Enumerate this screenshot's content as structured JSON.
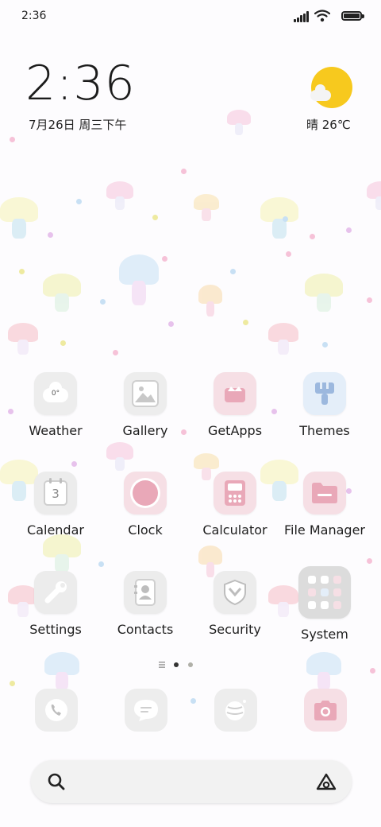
{
  "status_bar": {
    "time": "2:36",
    "signal_icon": "signal-bars-icon",
    "wifi_icon": "wifi-icon",
    "battery_icon": "battery-icon"
  },
  "clock_widget": {
    "time": "2:36",
    "date": "7月26日 周三下午"
  },
  "weather_widget": {
    "icon": "sun-cloud-icon",
    "text": "晴 26℃"
  },
  "apps": [
    {
      "label": "Weather",
      "icon": "weather-icon",
      "glyph": "0°"
    },
    {
      "label": "Gallery",
      "icon": "gallery-icon"
    },
    {
      "label": "GetApps",
      "icon": "getapps-icon"
    },
    {
      "label": "Themes",
      "icon": "themes-icon"
    },
    {
      "label": "Calendar",
      "icon": "calendar-icon",
      "glyph": "3"
    },
    {
      "label": "Clock",
      "icon": "clock-icon"
    },
    {
      "label": "Calculator",
      "icon": "calculator-icon"
    },
    {
      "label": "File Manager",
      "icon": "folder-icon"
    },
    {
      "label": "Settings",
      "icon": "wrench-icon"
    },
    {
      "label": "Contacts",
      "icon": "contacts-icon"
    },
    {
      "label": "Security",
      "icon": "shield-icon"
    },
    {
      "label": "System",
      "icon": "system-folder-icon"
    }
  ],
  "pager": {
    "icon": "menu-lines-icon",
    "pages": 2,
    "current_page": 1
  },
  "dock": [
    {
      "icon": "phone-icon"
    },
    {
      "icon": "message-icon"
    },
    {
      "icon": "browser-globe-icon"
    },
    {
      "icon": "camera-icon"
    }
  ],
  "search_bar": {
    "search_icon": "search-icon",
    "assistant_icon": "assistant-icon"
  },
  "colors": {
    "sun": "#f7c91e",
    "pink_icon": "#f6dfe5",
    "blue_icon": "#e4eef9",
    "gray_icon": "#ededed",
    "text": "#1e1e1e"
  }
}
